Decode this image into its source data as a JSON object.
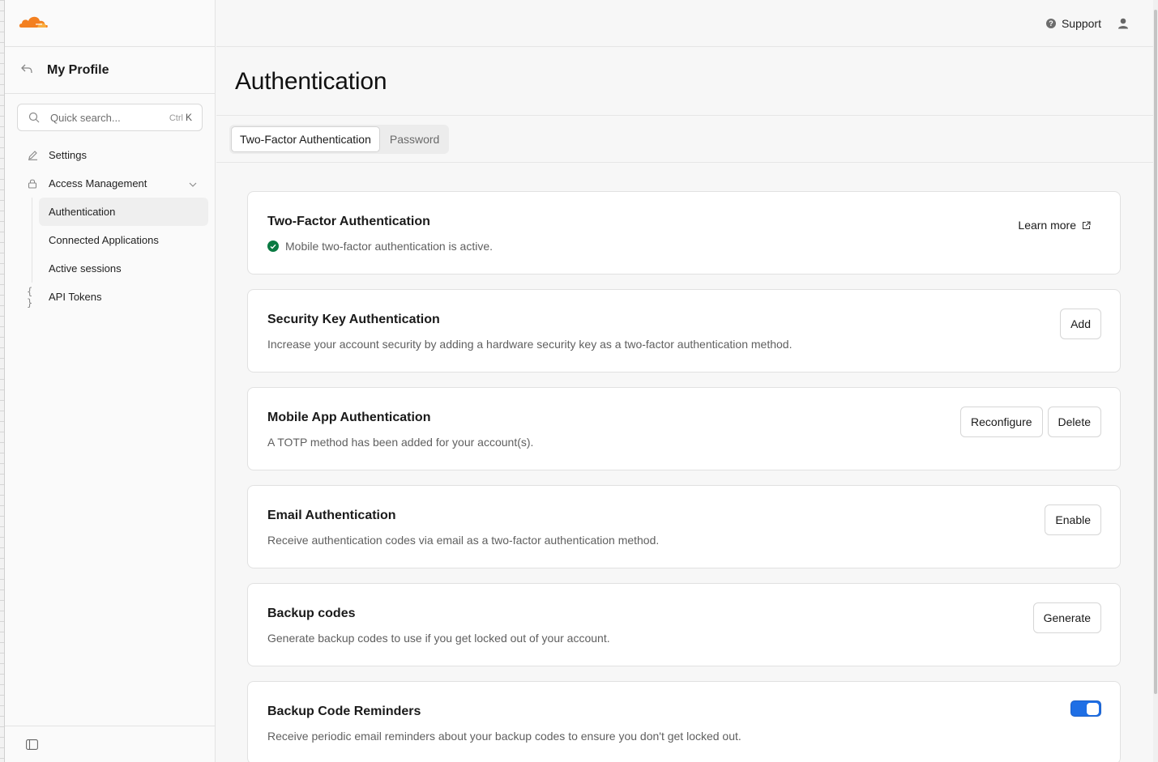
{
  "sidebar": {
    "back_title": "My Profile",
    "search": {
      "placeholder": "Quick search...",
      "shortcut_mod": "Ctrl",
      "shortcut_key": "K"
    },
    "items": [
      {
        "label": "Settings",
        "icon": "pencil-icon"
      },
      {
        "label": "Access Management",
        "icon": "lock-icon"
      },
      {
        "label": "API Tokens",
        "icon": "braces-icon"
      }
    ],
    "sub_items": [
      {
        "label": "Authentication",
        "active": true
      },
      {
        "label": "Connected Applications",
        "active": false
      },
      {
        "label": "Active sessions",
        "active": false
      }
    ]
  },
  "topbar": {
    "support_label": "Support"
  },
  "page": {
    "title": "Authentication"
  },
  "tabs": [
    {
      "label": "Two-Factor Authentication",
      "active": true
    },
    {
      "label": "Password",
      "active": false
    }
  ],
  "cards": {
    "two_factor": {
      "title": "Two-Factor Authentication",
      "desc": "Mobile two-factor authentication is active.",
      "link": "Learn more"
    },
    "security_key": {
      "title": "Security Key Authentication",
      "desc": "Increase your account security by adding a hardware security key as a two-factor authentication method.",
      "button": "Add"
    },
    "mobile_app": {
      "title": "Mobile App Authentication",
      "desc": "A TOTP method has been added for your account(s).",
      "button_reconfigure": "Reconfigure",
      "button_delete": "Delete"
    },
    "email": {
      "title": "Email Authentication",
      "desc": "Receive authentication codes via email as a two-factor authentication method.",
      "button": "Enable"
    },
    "backup_codes": {
      "title": "Backup codes",
      "desc": "Generate backup codes to use if you get locked out of your account.",
      "button": "Generate"
    },
    "backup_reminders": {
      "title": "Backup Code Reminders",
      "desc": "Receive periodic email reminders about your backup codes to ensure you don't get locked out.",
      "toggle_on": true
    }
  },
  "colors": {
    "brand": "#f38020",
    "accent": "#1f6fe5",
    "success": "#0a7a42"
  }
}
